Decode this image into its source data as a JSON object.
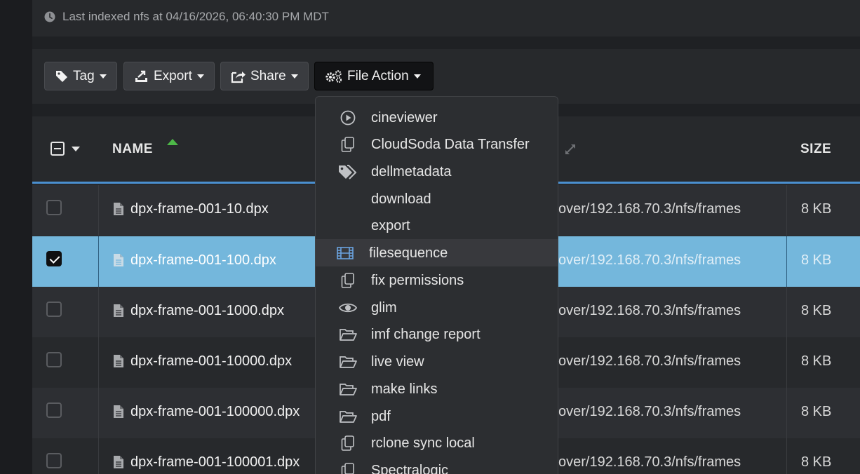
{
  "status": {
    "text": "Last indexed nfs at 04/16/2026, 06:40:30 PM MDT",
    "icon": "clock-icon"
  },
  "toolbar": {
    "tag_label": "Tag",
    "export_label": "Export",
    "share_label": "Share",
    "file_action_label": "File Action"
  },
  "table": {
    "columns": {
      "name": "NAME",
      "size": "SIZE"
    },
    "sort": "name-ascending",
    "rows": [
      {
        "name": "dpx-frame-001-10.dpx",
        "path": "over/192.168.70.3/nfs/frames",
        "size": "8 KB",
        "checked": false
      },
      {
        "name": "dpx-frame-001-100.dpx",
        "path": "over/192.168.70.3/nfs/frames",
        "size": "8 KB",
        "checked": true
      },
      {
        "name": "dpx-frame-001-1000.dpx",
        "path": "over/192.168.70.3/nfs/frames",
        "size": "8 KB",
        "checked": false
      },
      {
        "name": "dpx-frame-001-10000.dpx",
        "path": "over/192.168.70.3/nfs/frames",
        "size": "8 KB",
        "checked": false
      },
      {
        "name": "dpx-frame-001-100000.dpx",
        "path": "over/192.168.70.3/nfs/frames",
        "size": "8 KB",
        "checked": false
      },
      {
        "name": "dpx-frame-001-100001.dpx",
        "path": "over/192.168.70.3/nfs/frames",
        "size": "8 KB",
        "checked": false
      }
    ]
  },
  "menu": {
    "items": [
      {
        "label": "cineviewer",
        "icon": "play-circle-icon"
      },
      {
        "label": "CloudSoda Data Transfer",
        "icon": "copy-icon"
      },
      {
        "label": "dellmetadata",
        "icon": "tags-icon"
      },
      {
        "label": "download",
        "icon": ""
      },
      {
        "label": "export",
        "icon": ""
      },
      {
        "label": "filesequence",
        "icon": "film-icon"
      },
      {
        "label": "fix permissions",
        "icon": "copy-icon"
      },
      {
        "label": "glim",
        "icon": "eye-icon"
      },
      {
        "label": "imf change report",
        "icon": "folder-open-icon"
      },
      {
        "label": "live view",
        "icon": "folder-open-icon"
      },
      {
        "label": "make links",
        "icon": "folder-open-icon"
      },
      {
        "label": "pdf",
        "icon": "folder-open-icon"
      },
      {
        "label": "rclone sync local",
        "icon": "copy-icon"
      },
      {
        "label": "Spectralogic",
        "icon": "copy-icon"
      }
    ]
  },
  "colors": {
    "selected_row": "#74b7dc",
    "sort_indicator": "#4db848",
    "header_underline": "#4a8fd0",
    "accent_icon": "#6aa3e0"
  }
}
